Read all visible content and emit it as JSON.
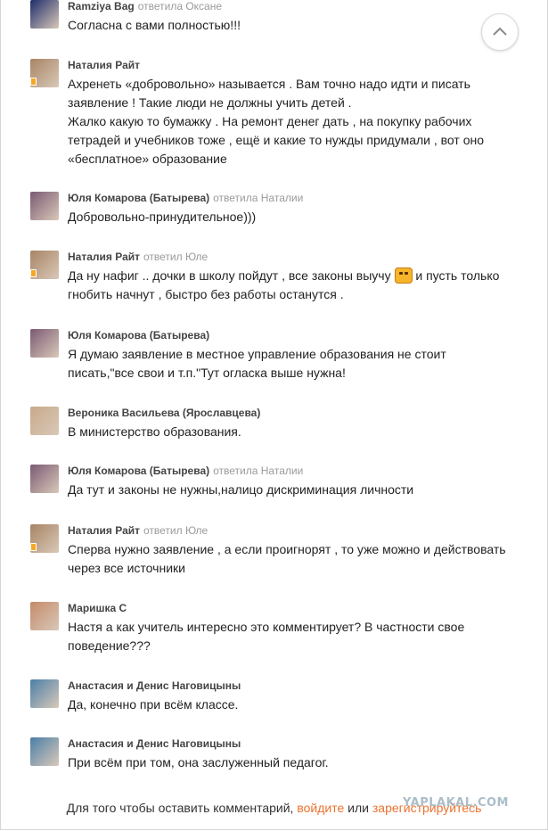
{
  "comments": [
    {
      "author": "Ramziya Bag",
      "reply": "ответила Оксане",
      "lines": [
        "Согласна с вами полностью!!!"
      ],
      "avatar_color": "#1e2d6b",
      "status": false
    },
    {
      "author": "Наталия Райт",
      "reply": "",
      "lines": [
        "Ахренеть «добровольно» называется . Вам точно надо идти и писать",
        "заявление ! Такие люди не должны учить детей .",
        "Жалко какую то бумажку . На ремонт денег дать , на покупку рабочих",
        "тетрадей и учебников тоже , ещё и какие то нужды придумали , вот оно",
        "«бесплатное» образование"
      ],
      "avatar_color": "#a88464",
      "status": true
    },
    {
      "author": "Юля Комарова (Батырева)",
      "reply": "ответила Наталии",
      "lines": [
        "Добровольно-принудительное)))"
      ],
      "avatar_color": "#7b5a73",
      "status": false
    },
    {
      "author": "Наталия Райт",
      "reply": "ответил Юле",
      "lines": [
        "Да ну нафиг .. дочки в школу пойдут , все законы выучу",
        "гнобить начнут , быстро без работы останутся ."
      ],
      "smiley_after": "и пусть только",
      "avatar_color": "#a88464",
      "status": true
    },
    {
      "author": "Юля Комарова (Батырева)",
      "reply": "",
      "lines": [
        "Я думаю заявление в местное управление образования не стоит",
        "писать,\"все свои и т.п.\"Тут огласка выше нужна!"
      ],
      "avatar_color": "#7b5a73",
      "status": false
    },
    {
      "author": "Вероника Васильева (Ярославцева)",
      "reply": "",
      "lines": [
        "В министерство образования."
      ],
      "avatar_color": "#c9a98a",
      "status": false
    },
    {
      "author": "Юля Комарова (Батырева)",
      "reply": "ответила Наталии",
      "lines": [
        "Да тут и законы не нужны,налицо дискриминация личности"
      ],
      "avatar_color": "#7b5a73",
      "status": false
    },
    {
      "author": "Наталия Райт",
      "reply": "ответил Юле",
      "lines": [
        "Сперва нужно заявление , а если проигнорят , то уже можно и действовать",
        "через все источники"
      ],
      "avatar_color": "#a88464",
      "status": true
    },
    {
      "author": "Маришка С",
      "reply": "",
      "lines": [
        "Настя а как учитель интересно это комментирует? В частности свое",
        "поведение???"
      ],
      "avatar_color": "#c58a6a",
      "status": false
    },
    {
      "author": "Анастасия и Денис Наговицыны",
      "reply": "",
      "lines": [
        "Да, конечно при всём классе."
      ],
      "avatar_color": "#4a7fa8",
      "status": false
    },
    {
      "author": "Анастасия и Денис Наговицыны",
      "reply": "",
      "lines": [
        "При всём при том, она заслуженный педагог."
      ],
      "avatar_color": "#4a7fa8",
      "status": false
    }
  ],
  "footer": {
    "prefix": "Для того чтобы оставить комментарий,",
    "login": "войдите",
    "middle": "или",
    "register": "зарегистрируйтесь"
  },
  "watermark": "YAPLAKAL.COM",
  "icons": {
    "scroll_top": "chevron-up-icon"
  }
}
